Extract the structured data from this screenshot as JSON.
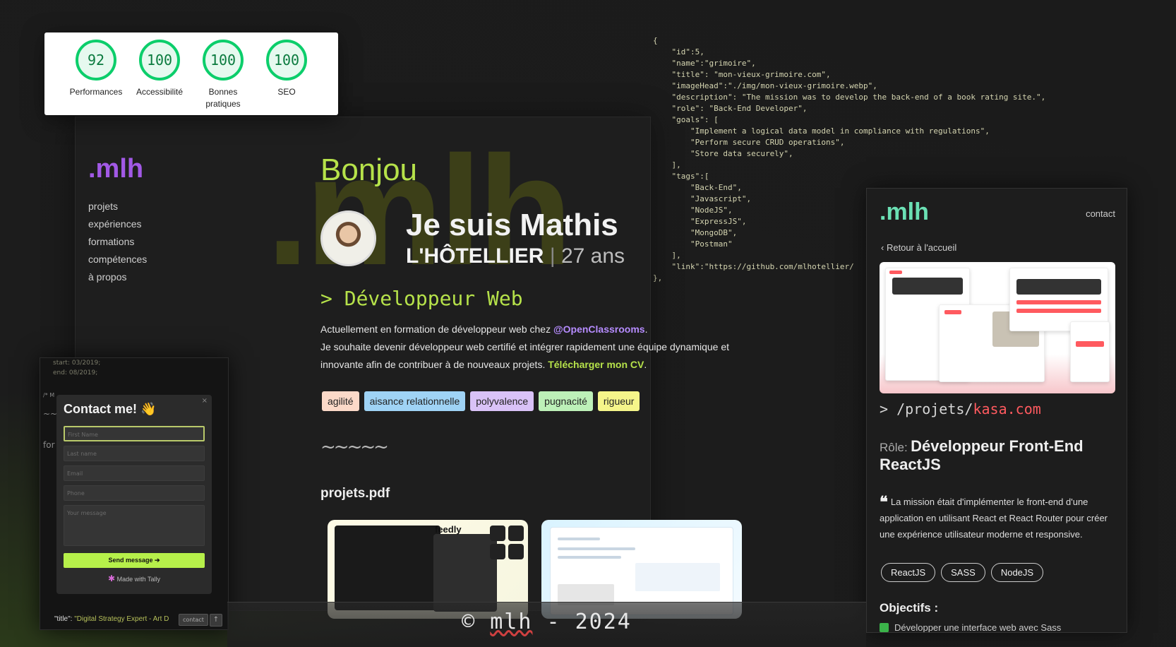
{
  "lighthouse": {
    "scores": [
      {
        "value": "92",
        "label": "Performances"
      },
      {
        "value": "100",
        "label": "Accessibilité"
      },
      {
        "value": "100",
        "label": "Bonnes pratiques"
      },
      {
        "value": "100",
        "label": "SEO"
      }
    ],
    "color": "#0cce6b"
  },
  "site": {
    "logo": ".mlh",
    "nav": [
      "projets",
      "expériences",
      "formations",
      "compétences",
      "à propos"
    ],
    "watermark": ".mlh",
    "greeting": "Bonjou",
    "name_line1": "Je suis Mathis",
    "name_last": "L'HÔTELLIER",
    "name_sep": "|",
    "age": "27 ans",
    "job": "> Développeur Web",
    "intro_part1": "Actuellement en formation de développeur web chez ",
    "intro_org": "@OpenClassrooms",
    "intro_part2": ".",
    "intro_part3": "Je souhaite devenir développeur web certifié et intégrer rapidement une équipe dynamique et innovante afin de contribuer à de nouveaux projets. ",
    "intro_cv": "Télécharger mon CV",
    "intro_part4": ".",
    "skills": [
      {
        "label": "agilité",
        "color": "#fbd9c8"
      },
      {
        "label": "aisance relationnelle",
        "color": "#9fd3f5"
      },
      {
        "label": "polyvalence",
        "color": "#d9c2f7"
      },
      {
        "label": "pugnacité",
        "color": "#bdf0b8"
      },
      {
        "label": "rigueur",
        "color": "#f5f58a"
      }
    ],
    "squiggle": "~~~~~",
    "projects_title": "projets.pdf",
    "thumb1_brand": "feedly",
    "accent_green": "#b6e24a",
    "accent_purple": "#a259e6"
  },
  "code": {
    "lines": [
      "{",
      "    \"id\":5,",
      "    \"name\":\"grimoire\",",
      "    \"title\": \"mon-vieux-grimoire.com\",",
      "    \"imageHead\":\"./img/mon-vieux-grimoire.webp\",",
      "    \"description\": \"The mission was to develop the back-end of a book rating site.\",",
      "    \"role\": \"Back-End Developer\",",
      "    \"goals\": [",
      "        \"Implement a logical data model in compliance with regulations\",",
      "        \"Perform secure CRUD operations\",",
      "        \"Store data securely\",",
      "    ],",
      "    \"tags\":[",
      "        \"Back-End\",",
      "        \"Javascript\",",
      "        \"NodeJS\",",
      "        \"ExpressJS\",",
      "        \"MongoDB\",",
      "        \"Postman\"",
      "    ],",
      "    \"link\":\"https://github.com/mlhotellier/",
      "},"
    ]
  },
  "mobile": {
    "logo": ".mlh",
    "contact": "contact",
    "back": "Retour à l'accueil",
    "path_prefix": "> /projets/",
    "path_site": "kasa.com",
    "role_label": "Rôle:",
    "role_value": "Développeur Front-End ReactJS",
    "quote_mark": "❝",
    "mission": "La mission était d'implémenter le front-end d'une application en utilisant React et React Router pour créer une expérience utilisateur moderne et responsive.",
    "tags": [
      "ReactJS",
      "SASS",
      "NodeJS"
    ],
    "objectives_title": "Objectifs :",
    "objective1": "Développer une interface web avec Sass",
    "accent": "#6be0b4"
  },
  "contact_form": {
    "title": "Contact me! 👋",
    "close": "×",
    "fields": [
      "First Name",
      "Last name",
      "Email",
      "Phone",
      "Your message"
    ],
    "send": "Send message ➔",
    "made_with": "Made with Tally",
    "bg_code": [
      "start: 03/2019;",
      "end: 08/2019;"
    ],
    "side_labels": [
      "/* M",
      "~~",
      "for"
    ],
    "bottom_key": "\"title\":",
    "bottom_value": "\"Digital Strategy Expert - Art D",
    "contact_btn": "contact",
    "up_btn": "↑"
  },
  "footer": {
    "copy": "©",
    "brand": "mlh",
    "rest": " - 2024"
  }
}
